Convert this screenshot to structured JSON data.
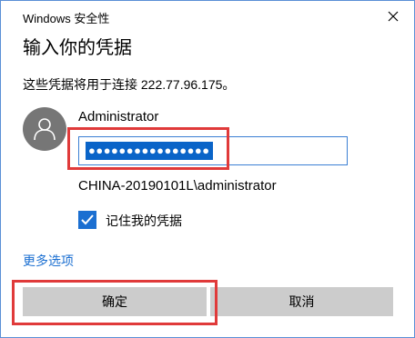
{
  "window": {
    "title": "Windows 安全性",
    "close_icon": "close-icon"
  },
  "dialog": {
    "heading": "输入你的凭据",
    "description": "这些凭据将用于连接 222.77.96.175。",
    "user": {
      "avatar_icon": "user-avatar-icon",
      "username": "Administrator",
      "password_masked": "●●●●●●●●●●●●●●●●",
      "domain_user": "CHINA-20190101L\\administrator"
    },
    "remember": {
      "label": "记住我的凭据",
      "checked": true
    },
    "more_options": "更多选项",
    "buttons": {
      "ok": "确定",
      "cancel": "取消"
    }
  },
  "colors": {
    "accent": "#1b6fd1",
    "highlight_box": "#e03a3a",
    "button_bg": "#cccccc",
    "avatar_bg": "#767676"
  }
}
